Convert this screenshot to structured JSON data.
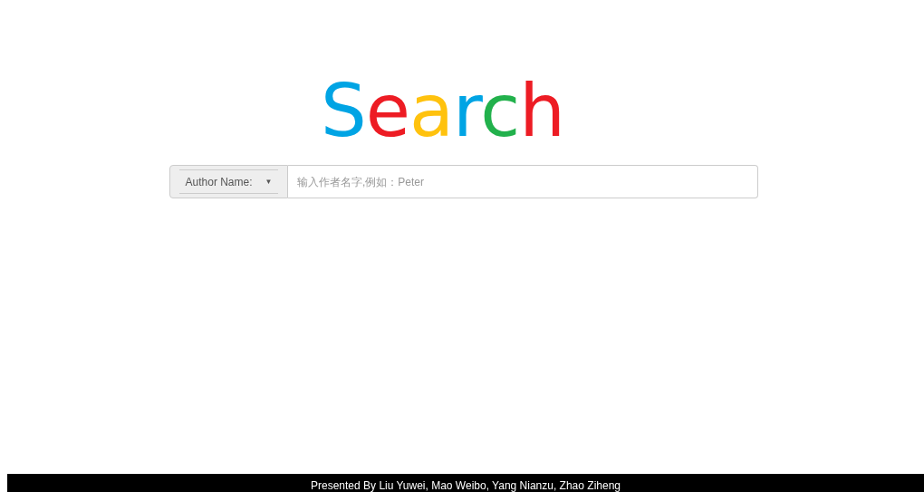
{
  "logo": {
    "letters": [
      {
        "char": "S",
        "color": "#00a4e4"
      },
      {
        "char": "e",
        "color": "#ed1c24"
      },
      {
        "char": "a",
        "color": "#ffc20e"
      },
      {
        "char": "r",
        "color": "#00a4e4"
      },
      {
        "char": "c",
        "color": "#22b14c"
      },
      {
        "char": "h",
        "color": "#ed1c24"
      }
    ]
  },
  "search": {
    "dropdown": {
      "label": "Author Name:",
      "caret": "▼"
    },
    "placeholder": "输入作者名字,例如：Peter"
  },
  "footer": {
    "text": "Presented By Liu Yuwei, Mao Weibo, Yang Nianzu, Zhao Ziheng"
  }
}
